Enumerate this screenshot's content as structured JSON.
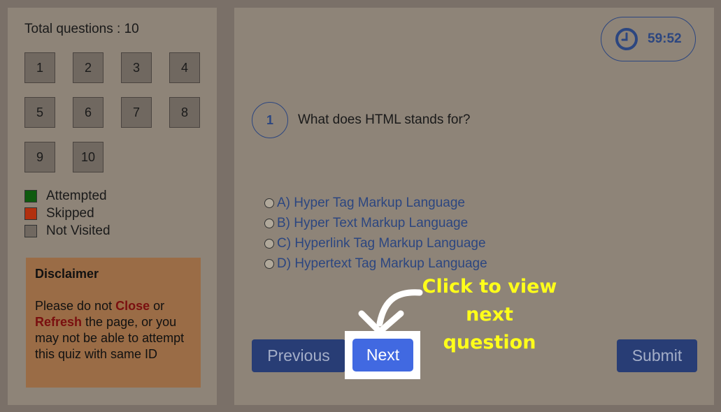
{
  "sidebar": {
    "total_label": "Total questions : 10",
    "questions": [
      "1",
      "2",
      "3",
      "4",
      "5",
      "6",
      "7",
      "8",
      "9",
      "10"
    ],
    "legend": [
      {
        "label": "Attempted",
        "color": "#0f5a0f"
      },
      {
        "label": "Skipped",
        "color": "#b2300f"
      },
      {
        "label": "Not Visited",
        "color": "#706860"
      }
    ],
    "disclaimer": {
      "title": "Disclaimer",
      "text1": "Please do not ",
      "close": "Close",
      "text2": " or ",
      "refresh": "Refresh",
      "text3": " the page, or you may not be able to attempt this quiz with same ID"
    }
  },
  "timer": {
    "icon": "clock-icon",
    "value": "59:52"
  },
  "question": {
    "number": "1",
    "text": "What does HTML stands for?",
    "options": [
      "A) Hyper Tag Markup Language",
      "B) Hyper Text Markup Language",
      "C) Hyperlink Tag Markup Language",
      "D) Hypertext Tag Markup Language"
    ]
  },
  "buttons": {
    "previous": "Previous",
    "next": "Next",
    "submit": "Submit"
  },
  "annotation": {
    "line1": "Click to view",
    "line2": "next question"
  },
  "colors": {
    "accent": "#2c4680",
    "next": "#4169e1",
    "callout": "#ffff1a"
  }
}
